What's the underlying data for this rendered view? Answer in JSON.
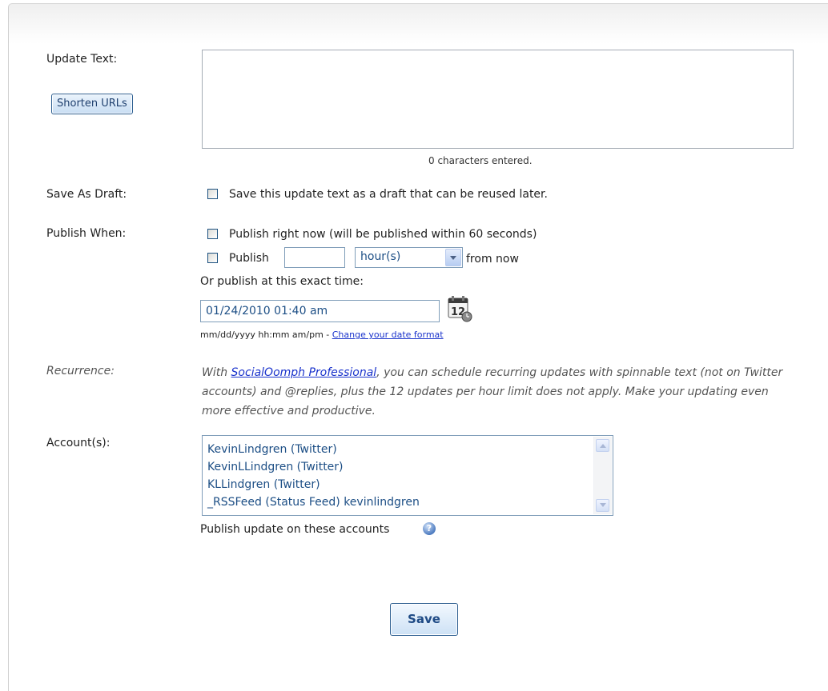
{
  "form": {
    "update_text": {
      "label": "Update Text:",
      "shorten_button": "Shorten URLs",
      "value": "",
      "counter": "0 characters entered."
    },
    "save_as_draft": {
      "label": "Save As Draft:",
      "checkbox_label": "Save this update text as a draft that can be reused later.",
      "checked": false
    },
    "publish_when": {
      "label": "Publish When:",
      "now_label": "Publish right now (will be published within 60 seconds)",
      "relative_prefix": "Publish",
      "relative_amount": "",
      "relative_unit": "hour(s)",
      "relative_suffix": "from now",
      "exact_label": "Or publish at this exact time:",
      "exact_value": "01/24/2010 01:40 am",
      "calendar_day": "12",
      "format_hint": "mm/dd/yyyy hh:mm am/pm - ",
      "format_link": "Change your date format"
    },
    "recurrence": {
      "label": "Recurrence:",
      "text_before": "With ",
      "link": "SocialOomph Professional",
      "text_after": ", you can schedule recurring updates with spinnable text (not on Twitter accounts) and @replies, plus the 12 updates per hour limit does not apply. Make your updating even more effective and productive."
    },
    "accounts": {
      "label": "Account(s):",
      "items": [
        "KevinLindgren (Twitter)",
        "KevinLLindgren (Twitter)",
        "KLLindgren (Twitter)",
        "_RSSFeed (Status Feed) kevinlindgren"
      ],
      "hint": "Publish update on these accounts"
    },
    "save_button": "Save"
  }
}
